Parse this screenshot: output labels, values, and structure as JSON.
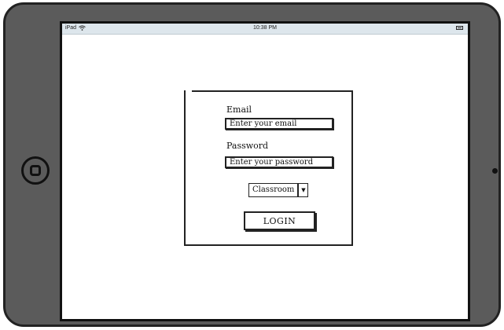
{
  "status_bar": {
    "device_label": "iPad",
    "wifi_icon": "wifi-icon",
    "time": "10:38 PM",
    "battery_icon": "battery-icon"
  },
  "login_form": {
    "email_label": "Email",
    "email_placeholder": "Enter your email",
    "password_label": "Password",
    "password_placeholder": "Enter your password",
    "role_select": {
      "selected": "Classroom",
      "arrow_icon": "chevron-down-icon"
    },
    "login_button_label": "LOGIN"
  },
  "colors": {
    "device_frame": "#5b5b5b",
    "status_bar_bg": "#dde6ec",
    "stroke": "#222222"
  }
}
